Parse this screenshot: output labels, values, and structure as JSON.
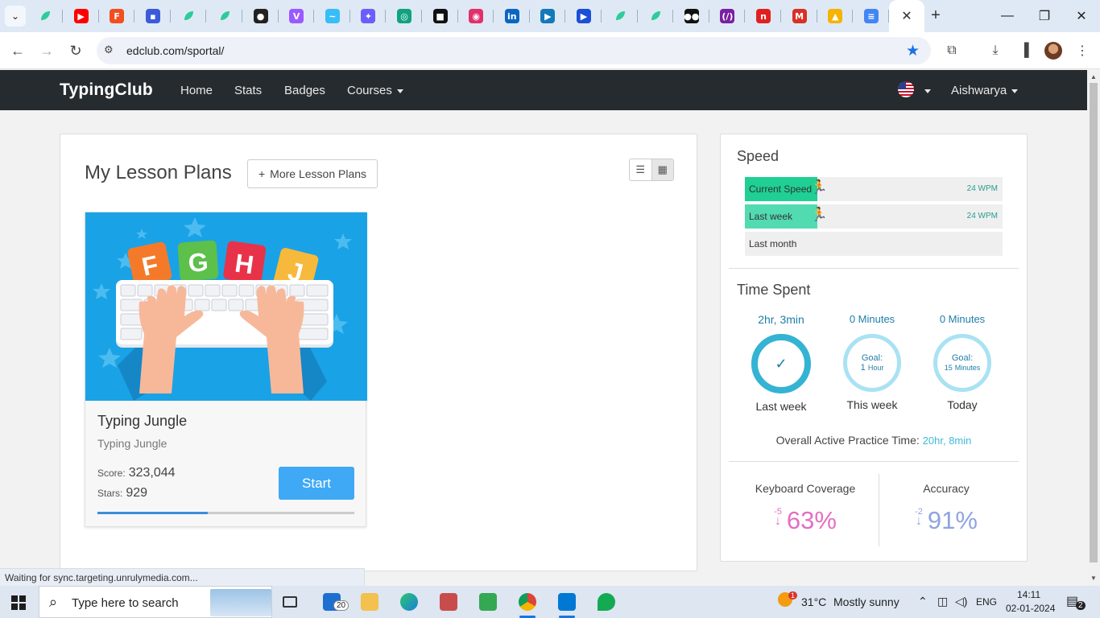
{
  "browser": {
    "tabs": [
      {
        "icon": "leaf-icon",
        "color": "#2ecc9a",
        "glyph": ""
      },
      {
        "icon": "youtube-icon",
        "color": "#ff0000",
        "glyph": "▶"
      },
      {
        "icon": "figma-icon",
        "color": "#f24e1e",
        "glyph": "F"
      },
      {
        "icon": "app-icon",
        "color": "#3b5bdb",
        "glyph": "▪"
      },
      {
        "icon": "leaf-icon",
        "color": "#2ecc9a",
        "glyph": ""
      },
      {
        "icon": "leaf-icon",
        "color": "#2ecc9a",
        "glyph": ""
      },
      {
        "icon": "github-icon",
        "color": "#222222",
        "glyph": "●"
      },
      {
        "icon": "vite-icon",
        "color": "#9b59ff",
        "glyph": "V"
      },
      {
        "icon": "tailwind-icon",
        "color": "#38bdf8",
        "glyph": "~"
      },
      {
        "icon": "sparkle-icon",
        "color": "#6d5dfc",
        "glyph": "✦"
      },
      {
        "icon": "openai-icon",
        "color": "#10a37f",
        "glyph": "◎"
      },
      {
        "icon": "unsplash-icon",
        "color": "#111111",
        "glyph": "■"
      },
      {
        "icon": "instagram-icon",
        "color": "#e1306c",
        "glyph": "◉"
      },
      {
        "icon": "linkedin-icon",
        "color": "#0a66c2",
        "glyph": "in"
      },
      {
        "icon": "play-icon",
        "color": "#1479b8",
        "glyph": "▶"
      },
      {
        "icon": "play-icon",
        "color": "#1b4fd8",
        "glyph": "▶"
      },
      {
        "icon": "leaf-icon",
        "color": "#2ecc9a",
        "glyph": ""
      },
      {
        "icon": "leaf-icon",
        "color": "#2ecc9a",
        "glyph": ""
      },
      {
        "icon": "medium-icon",
        "color": "#111111",
        "glyph": "●●"
      },
      {
        "icon": "code-icon",
        "color": "#7a1fa2",
        "glyph": "(/)"
      },
      {
        "icon": "n-icon",
        "color": "#e02020",
        "glyph": "n"
      },
      {
        "icon": "gmail-icon",
        "color": "#d93025",
        "glyph": "M"
      },
      {
        "icon": "drive-icon",
        "color": "#f4b400",
        "glyph": "▲"
      },
      {
        "icon": "docs-icon",
        "color": "#4285f4",
        "glyph": "≡"
      }
    ],
    "active_tab_close": "✕",
    "new_tab": "+",
    "url": "edclub.com/sportal/"
  },
  "site": {
    "brand": "TypingClub",
    "nav": {
      "home": "Home",
      "stats": "Stats",
      "badges": "Badges",
      "courses": "Courses",
      "user": "Aishwarya"
    }
  },
  "lessons": {
    "title": "My Lesson Plans",
    "more_button": "More Lesson Plans",
    "more_button_icon": "+",
    "card": {
      "name": "Typing Jungle",
      "subtitle": "Typing Jungle",
      "score_label": "Score:",
      "score": "323,044",
      "stars_label": "Stars:",
      "stars": "929",
      "start": "Start",
      "progress": 0.43,
      "letters": [
        "F",
        "G",
        "H",
        "J"
      ]
    }
  },
  "speed": {
    "title": "Speed",
    "rows": [
      {
        "label": "Current Speed",
        "wpm": "24 WPM",
        "fill": 0.28,
        "color": "#1fcf94"
      },
      {
        "label": "Last week",
        "wpm": "24 WPM",
        "fill": 0.28,
        "color": "#52dbb0"
      },
      {
        "label": "Last month",
        "wpm": "",
        "fill": 0,
        "color": "#52dbb0"
      }
    ]
  },
  "time_spent": {
    "title": "Time Spent",
    "last_week": {
      "value": "2hr, 3min",
      "caption": "Last week"
    },
    "this_week": {
      "value": "0 Minutes",
      "goal_label": "Goal:",
      "goal_num": "1",
      "goal_unit": "Hour",
      "caption": "This week"
    },
    "today": {
      "value": "0 Minutes",
      "goal_label": "Goal:",
      "goal_num": "15",
      "goal_unit": "Minutes",
      "caption": "Today"
    },
    "overall_label": "Overall Active Practice Time:",
    "overall_value": "20hr, 8min"
  },
  "stats": {
    "coverage": {
      "label": "Keyboard Coverage",
      "delta": "-5",
      "value": "63%",
      "color": "#e36fc3"
    },
    "accuracy": {
      "label": "Accuracy",
      "delta": "-2",
      "value": "91%",
      "color": "#8fa4e0"
    }
  },
  "status_bar": "Waiting for sync.targeting.unrulymedia.com...",
  "taskbar": {
    "search_placeholder": "Type here to search",
    "mail_badge": "20",
    "weather_temp": "31°C",
    "weather_text": "Mostly sunny",
    "weather_alert": "1",
    "language": "ENG",
    "time": "14:11",
    "date": "02-01-2024",
    "notifications": "2"
  }
}
